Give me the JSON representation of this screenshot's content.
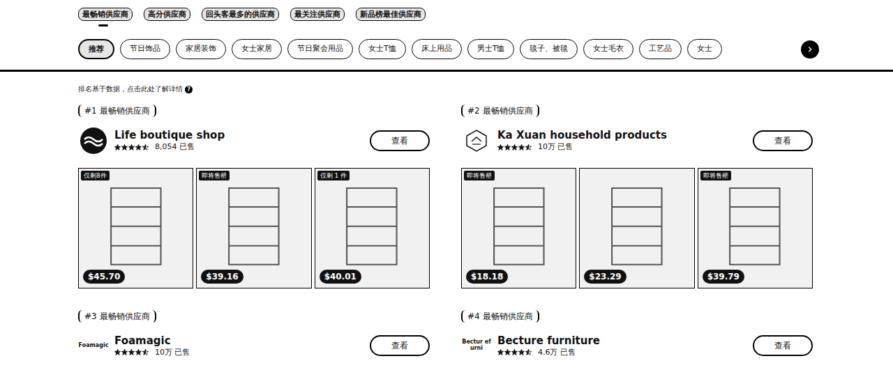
{
  "tabs": [
    {
      "label": "最畅销供应商",
      "selected": true
    },
    {
      "label": "高分供应商",
      "selected": false
    },
    {
      "label": "回头客最多的供应商",
      "selected": false
    },
    {
      "label": "最关注供应商",
      "selected": false
    },
    {
      "label": "新品榜最佳供应商",
      "selected": false
    }
  ],
  "categories": [
    {
      "label": "推荐",
      "selected": true
    },
    {
      "label": "节日饰品",
      "selected": false
    },
    {
      "label": "家居装饰",
      "selected": false
    },
    {
      "label": "女士家居",
      "selected": false
    },
    {
      "label": "节日聚会用品",
      "selected": false
    },
    {
      "label": "女士T恤",
      "selected": false
    },
    {
      "label": "床上用品",
      "selected": false
    },
    {
      "label": "男士T恤",
      "selected": false
    },
    {
      "label": "毯子、被毯",
      "selected": false
    },
    {
      "label": "女士毛衣",
      "selected": false
    },
    {
      "label": "工艺品",
      "selected": false
    },
    {
      "label": "女士",
      "selected": false
    }
  ],
  "scroll_button": "›",
  "notice": {
    "text": "排名基于数据，点击此处了解详情",
    "icon": "?"
  },
  "suppliers": [
    {
      "rank": "#1 最畅销供应商",
      "name": "Life boutique shop",
      "logo": {
        "kind": "icon"
      },
      "stars": 4.5,
      "sold": "8,054 已售",
      "button": "查看",
      "products": [
        {
          "badge": "仅剩8件",
          "price": "$45.70"
        },
        {
          "badge": "即将售罄",
          "price": "$39.16"
        },
        {
          "badge": "仅剩 1 件",
          "price": "$40.01"
        }
      ]
    },
    {
      "rank": "#2 最畅销供应商",
      "name": "Ka Xuan household products",
      "logo": {
        "kind": "badge"
      },
      "stars": 4.5,
      "sold": "10万 已售",
      "button": "查看",
      "products": [
        {
          "badge": "即将售罄",
          "price": "$18.18"
        },
        {
          "price": "$23.29"
        },
        {
          "badge": "即将售罄",
          "price": "$39.79"
        }
      ]
    },
    {
      "rank": "#3 最畅销供应商",
      "name": "Foamagic",
      "logo": {
        "kind": "text",
        "text": "Foamagic"
      },
      "stars": 4.5,
      "sold": "10万 已售",
      "button": "查看",
      "products": []
    },
    {
      "rank": "#4 最畅销供应商",
      "name": "Becture furniture",
      "logo": {
        "kind": "text",
        "text": "Bectur efurni"
      },
      "stars": 4.5,
      "sold": "4.6万 已售",
      "button": "查看",
      "products": []
    }
  ]
}
